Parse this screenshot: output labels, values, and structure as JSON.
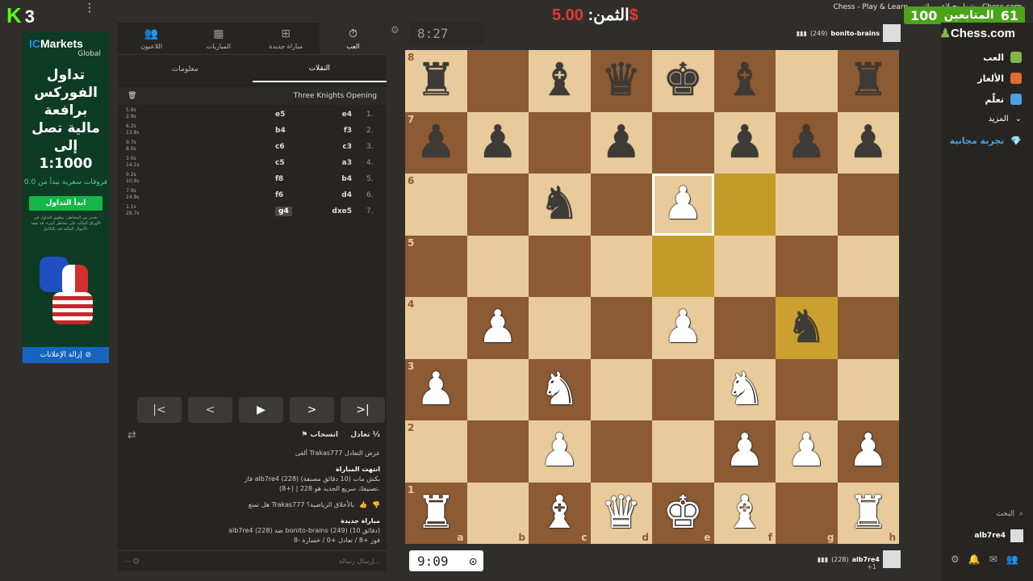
{
  "window_title": "Chess - Play & Learn - شطرنج لاعبين اثنين - Chess.com",
  "kick": {
    "logo": "K",
    "count": "3"
  },
  "top_menu_icon": "⋮",
  "prize": {
    "label": "الثمن:",
    "amount": "5.00$"
  },
  "followers": {
    "label": "المتابعين",
    "count": "61",
    "target": "100"
  },
  "ad": {
    "brand": "IC",
    "brand2": "Markets",
    "brand_sub": "Global",
    "headline": "تداول الفوركس برافعة مالية تصل إلى 1:1000",
    "spreads": "فروقات سعرية تبدأ من 0.0",
    "cta": "ابدأ التداول",
    "disclaimer": "تحذير من المخاطر: ينطوي التداول في الأوراق المالية على مخاطر كبيرة. قد تفقد الأموال المالية فيه بالكامل.",
    "remove": "إزالة الإعلانات"
  },
  "panel": {
    "tabs": [
      {
        "label": "اللاعبون",
        "icon": "users-icon"
      },
      {
        "label": "المباريات",
        "icon": "board-icon"
      },
      {
        "label": "مباراة جديدة",
        "icon": "plus-icon"
      },
      {
        "label": "العب",
        "icon": "clock-icon"
      }
    ],
    "sub_tabs": [
      "معلومات",
      "النقلات"
    ],
    "opening": "Three Knights Opening",
    "moves": [
      {
        "n": "1.",
        "white": "e4",
        "black": "e5",
        "t1": "5.8s",
        "t2": "2.9s"
      },
      {
        "n": "2.",
        "white": "f3",
        "black": "b4",
        "t1": "6.2s",
        "t2": "13.9s"
      },
      {
        "n": "3.",
        "white": "c3",
        "black": "c6",
        "t1": "9.7s",
        "t2": "8.0s"
      },
      {
        "n": "4.",
        "white": "a3",
        "black": "c5",
        "t1": "3.0s",
        "t2": "14.1s"
      },
      {
        "n": "5.",
        "white": "b4",
        "black": "f8",
        "t1": "9.2s",
        "t2": "10.9s"
      },
      {
        "n": "6.",
        "white": "d4",
        "black": "f6",
        "t1": "7.9s",
        "t2": "14.9s"
      },
      {
        "n": "7.",
        "white": "dxe5",
        "black": "g4",
        "t1": "1.1s",
        "t2": "28.7s"
      }
    ],
    "actions": {
      "draw": "تعادل ½",
      "resign": "انسحاب"
    },
    "chat": {
      "declined": "ألغى Trakas777 عرض التعادل",
      "game_over_title": "انتهت المباراة",
      "game_over_1": "فاز alb7re4 (228) بكش مات (10 دقائق مصنفة)",
      "game_over_2": "تصنيفك سريع الجديد هو 228 | (+8).",
      "rate_q": "هل تمتع Trakas777 بالأخلاق الرياضية؟",
      "new_game_title": "مباراة جديدة",
      "new_game_1": "alb7re4 (228) ضد bonito-brains (249) (10 دقائق)",
      "new_game_2": "فوز +8 / تعادل +0 / خسارة -8",
      "input_placeholder": "إرسال رسالة..."
    }
  },
  "clock_top": "8:27",
  "clock_bottom": "9:09",
  "player_top": {
    "name": "bonito-brains",
    "rating": "(249)"
  },
  "player_bottom": {
    "name": "alb7re4",
    "rating": "(228)",
    "score": "+1"
  },
  "board": {
    "ranks": [
      "8",
      "7",
      "6",
      "5",
      "4",
      "3",
      "2",
      "1"
    ],
    "files": [
      "a",
      "b",
      "c",
      "d",
      "e",
      "f",
      "g",
      "h"
    ],
    "position": [
      [
        "bR",
        "",
        "bB",
        "bQ",
        "bK",
        "bB",
        "",
        "bR"
      ],
      [
        "bP",
        "bP",
        "",
        "bP",
        "",
        "bP",
        "bP",
        "bP"
      ],
      [
        "",
        "",
        "bN",
        "",
        "wP",
        "",
        "",
        ""
      ],
      [
        "",
        "",
        "",
        "",
        "",
        "",
        "",
        ""
      ],
      [
        "",
        "wP",
        "",
        "",
        "wP",
        "",
        "bN",
        ""
      ],
      [
        "wP",
        "",
        "wN",
        "",
        "",
        "wN",
        "",
        ""
      ],
      [
        "",
        "",
        "wP",
        "",
        "",
        "wP",
        "wP",
        "wP"
      ],
      [
        "wR",
        "",
        "wB",
        "wQ",
        "wK",
        "wB",
        "",
        "wR"
      ]
    ],
    "highlight": [
      "f6",
      "e5",
      "g4"
    ],
    "hover": "e6"
  },
  "sidebar": {
    "logo": "Chess",
    "logo_suffix": ".com",
    "items": [
      {
        "label": "العب",
        "color": "#81b64c"
      },
      {
        "label": "الألغاز",
        "color": "#e36b2c"
      },
      {
        "label": "تعلّم",
        "color": "#4aa3df"
      },
      {
        "label": "المزيد",
        "color": "#888"
      },
      {
        "label": "تجربة مجانية",
        "color": "#4aa3df"
      }
    ],
    "search": "البحث",
    "user": "alb7re4"
  }
}
